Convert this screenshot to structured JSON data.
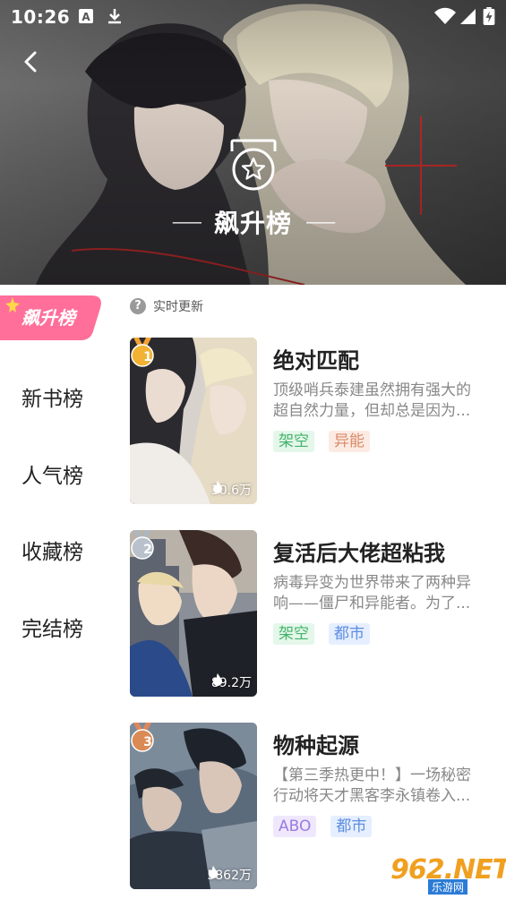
{
  "status_bar": {
    "time": "10:26",
    "icons": [
      "a-badge-icon",
      "download-icon",
      "wifi-icon",
      "signal-icon",
      "battery-charging-icon"
    ]
  },
  "header": {
    "back_icon": "chevron-left-icon",
    "emblem_icon": "star-medal-icon",
    "title": "飙升榜",
    "dash_left": "—— ",
    "dash_right": " ——"
  },
  "tag_badge": {
    "label": "飙升榜",
    "color": "#ff6f9a"
  },
  "side_nav": {
    "items": [
      {
        "label": "新书榜"
      },
      {
        "label": "人气榜"
      },
      {
        "label": "收藏榜"
      },
      {
        "label": "完结榜"
      }
    ]
  },
  "realtime": {
    "icon": "question-mark-icon",
    "label": "实时更新"
  },
  "list": {
    "items": [
      {
        "rank": "1",
        "medal_color": "#f2b233",
        "heat": "30.6万",
        "title": "绝对匹配",
        "desc_lines": [
          "顶级哨兵泰建虽然拥有强大的",
          "超自然力量，但却总是因为..."
        ],
        "tags": [
          {
            "label": "架空",
            "style": "green"
          },
          {
            "label": "异能",
            "style": "orange"
          }
        ]
      },
      {
        "rank": "2",
        "medal_color": "#b9c2cc",
        "heat": "89.2万",
        "title": "复活后大佬超粘我",
        "desc_lines": [
          "病毒异变为世界带来了两种异",
          "响——僵尸和异能者。为了..."
        ],
        "tags": [
          {
            "label": "架空",
            "style": "green"
          },
          {
            "label": "都市",
            "style": "blue"
          }
        ]
      },
      {
        "rank": "3",
        "medal_color": "#d98a55",
        "heat": "5862万",
        "title": "物种起源",
        "desc_lines": [
          "【第三季热更中！】一场秘密",
          "行动将天才黑客李永镇卷入..."
        ],
        "tags": [
          {
            "label": "ABO",
            "style": "purple"
          },
          {
            "label": "都市",
            "style": "blue"
          }
        ]
      }
    ]
  },
  "watermark": {
    "text": "962.NET",
    "sub": "乐游网"
  }
}
